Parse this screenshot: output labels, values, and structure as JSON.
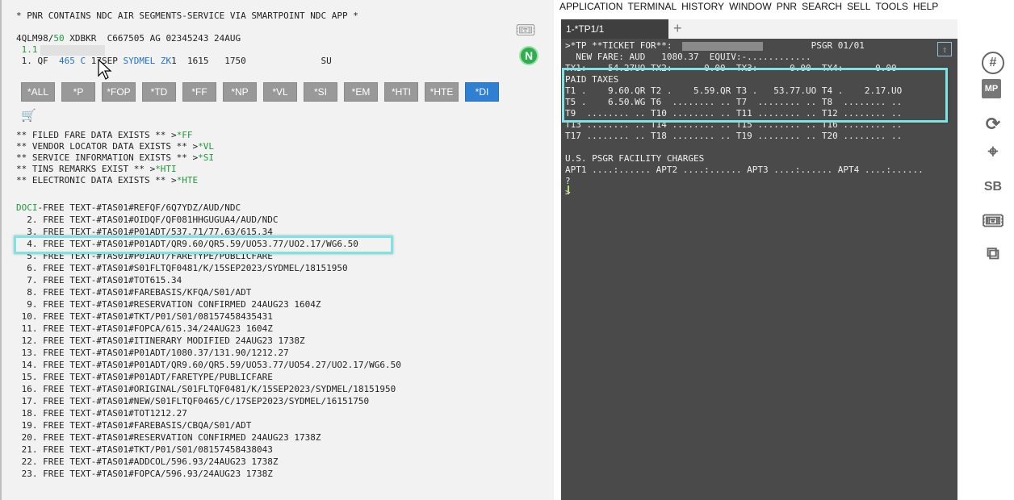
{
  "left": {
    "header": "* PNR CONTAINS NDC AIR SEGMENTS-SERVICE VIA SMARTPOINT NDC APP *",
    "pnr_line_prefix": "4QLM98/",
    "pnr_line_num": "50",
    "pnr_line_rest": " XDBKR  C667505 AG 02345243 24AUG",
    "name_line": " 1.1",
    "seg_prefix": " 1. QF  ",
    "seg_flight": "465 C",
    "seg_date": " 17SEP ",
    "seg_route": "SYDMEL ZK",
    "seg_rest": "1  1615   1750              SU",
    "buttons": [
      "*ALL",
      "*P",
      "*FOP",
      "*TD",
      "*FF",
      "*NP",
      "*VL",
      "*SI",
      "*EM",
      "*HTI",
      "*HTE",
      "*DI"
    ],
    "active_button": "*DI",
    "exists": [
      {
        "text": "** FILED FARE DATA EXISTS ** >",
        "link": "*FF"
      },
      {
        "text": "** VENDOR LOCATOR DATA EXISTS ** >",
        "link": "*VL"
      },
      {
        "text": "** SERVICE INFORMATION EXISTS ** >",
        "link": "*SI"
      },
      {
        "text": "** TINS REMARKS EXIST ** >",
        "link": "*HTI"
      },
      {
        "text": "** ELECTRONIC DATA EXISTS ** >",
        "link": "*HTE"
      }
    ],
    "doci_label": "DOCI",
    "docs": [
      "-FREE TEXT-#TAS01#REFQF/6Q7YDZ/AUD/NDC",
      "  2. FREE TEXT-#TAS01#OIDQF/QF081HHGUGUA4/AUD/NDC",
      "  3. FREE TEXT-#TAS01#P01ADT/537.71/77.63/615.34",
      "  4. FREE TEXT-#TAS01#P01ADT/QR9.60/QR5.59/UO53.77/UO2.17/WG6.50",
      "  5. FREE TEXT-#TAS01#P01ADT/FARETYPE/PUBLICFARE",
      "  6. FREE TEXT-#TAS01#S01FLTQF0481/K/15SEP2023/SYDMEL/18151950",
      "  7. FREE TEXT-#TAS01#TOT615.34",
      "  8. FREE TEXT-#TAS01#FAREBASIS/KFQA/S01/ADT",
      "  9. FREE TEXT-#TAS01#RESERVATION CONFIRMED 24AUG23 1604Z",
      " 10. FREE TEXT-#TAS01#TKT/P01/S01/08157458435431",
      " 11. FREE TEXT-#TAS01#FOPCA/615.34/24AUG23 1604Z",
      " 12. FREE TEXT-#TAS01#ITINERARY MODIFIED 24AUG23 1738Z",
      " 13. FREE TEXT-#TAS01#P01ADT/1080.37/131.90/1212.27",
      " 14. FREE TEXT-#TAS01#P01ADT/QR9.60/QR5.59/UO53.77/UO54.27/UO2.17/WG6.50",
      " 15. FREE TEXT-#TAS01#P01ADT/FARETYPE/PUBLICFARE",
      " 16. FREE TEXT-#TAS01#ORIGINAL/S01FLTQF0481/K/15SEP2023/SYDMEL/18151950",
      " 17. FREE TEXT-#TAS01#NEW/S01FLTQF0465/C/17SEP2023/SYDMEL/16151750",
      " 18. FREE TEXT-#TAS01#TOT1212.27",
      " 19. FREE TEXT-#TAS01#FAREBASIS/CBQA/S01/ADT",
      " 20. FREE TEXT-#TAS01#RESERVATION CONFIRMED 24AUG23 1738Z",
      " 21. FREE TEXT-#TAS01#TKT/P01/S01/08157458438043",
      " 22. FREE TEXT-#TAS01#ADDCOL/596.93/24AUG23 1738Z",
      " 23. FREE TEXT-#TAS01#FOPCA/596.93/24AUG23 1738Z"
    ]
  },
  "menu": [
    "APPLICATION",
    "TERMINAL",
    "HISTORY",
    "WINDOW",
    "PNR",
    "SEARCH",
    "SELL",
    "TOOLS",
    "HELP"
  ],
  "terminal": {
    "tab_label": "1-*TP1/1",
    "tab_add": "+",
    "lines": [
      ">*TP **TICKET FOR**:                          PSGR 01/01",
      "  NEW FARE: AUD   1080.37  EQUIV:-............",
      "TX1:    54.27UO TX2:      0.00  TX3:      0.00  TX4:      0.00",
      "PAID TAXES",
      "T1 .    9.60.QR T2 .    5.59.QR T3 .   53.77.UO T4 .    2.17.UO",
      "T5 .    6.50.WG T6  ........ .. T7  ........ .. T8  ........ ..",
      "T9  ........ .. T10 ........ .. T11 ........ .. T12 ........ ..",
      "T13 ........ .. T14 ........ .. T15 ........ .. T16 ........ ..",
      "T17 ........ .. T18 ........ .. T19 ........ .. T20 ........ ..",
      "",
      "U.S. PSGR FACILITY CHARGES",
      "APT1 ....:...... APT2 ....:...... APT3 ....:...... APT4 ....:......",
      "?",
      ">"
    ]
  },
  "rail": [
    {
      "name": "hash-icon",
      "glyph": "#"
    },
    {
      "name": "mp-icon",
      "glyph": "MP"
    },
    {
      "name": "refresh-icon",
      "glyph": "⟳"
    },
    {
      "name": "hotel-pin-icon",
      "glyph": "⌖"
    },
    {
      "name": "sb-icon",
      "glyph": "SB"
    },
    {
      "name": "ticket-icon",
      "glyph": "🎟"
    },
    {
      "name": "external-link-icon",
      "glyph": "⧉"
    }
  ],
  "left_icons": {
    "n_badge": "N",
    "ticket_glyph": "🎟",
    "cart_glyph": "🛒"
  }
}
